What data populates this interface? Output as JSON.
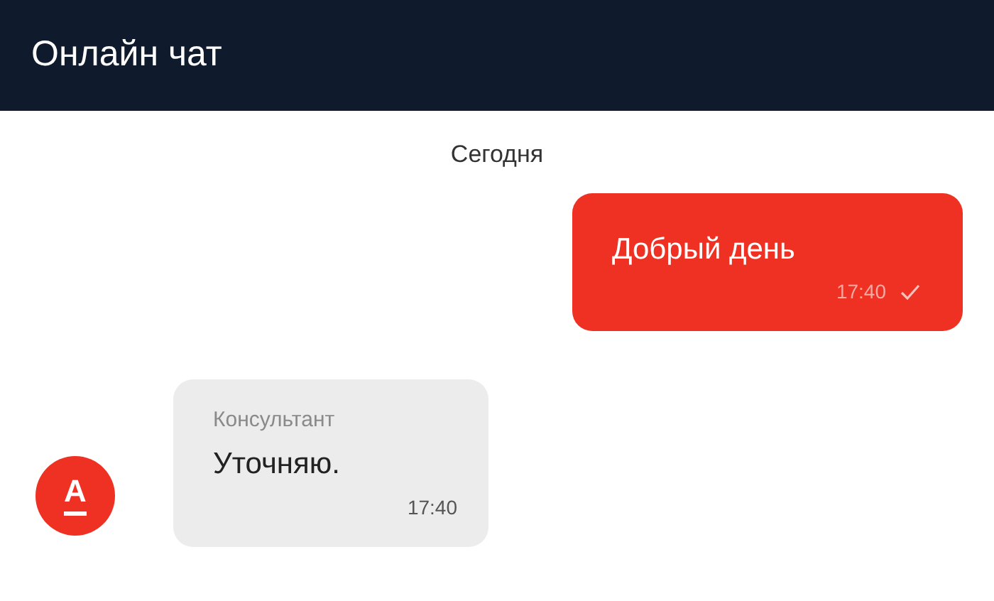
{
  "header": {
    "title": "Онлайн чат"
  },
  "date_separator": "Сегодня",
  "messages": [
    {
      "kind": "outgoing",
      "text": "Добрый день",
      "time": "17:40",
      "delivered": true
    },
    {
      "kind": "incoming",
      "sender": "Консультант",
      "avatar_letter": "А",
      "text": "Уточняю.",
      "time": "17:40"
    }
  ]
}
